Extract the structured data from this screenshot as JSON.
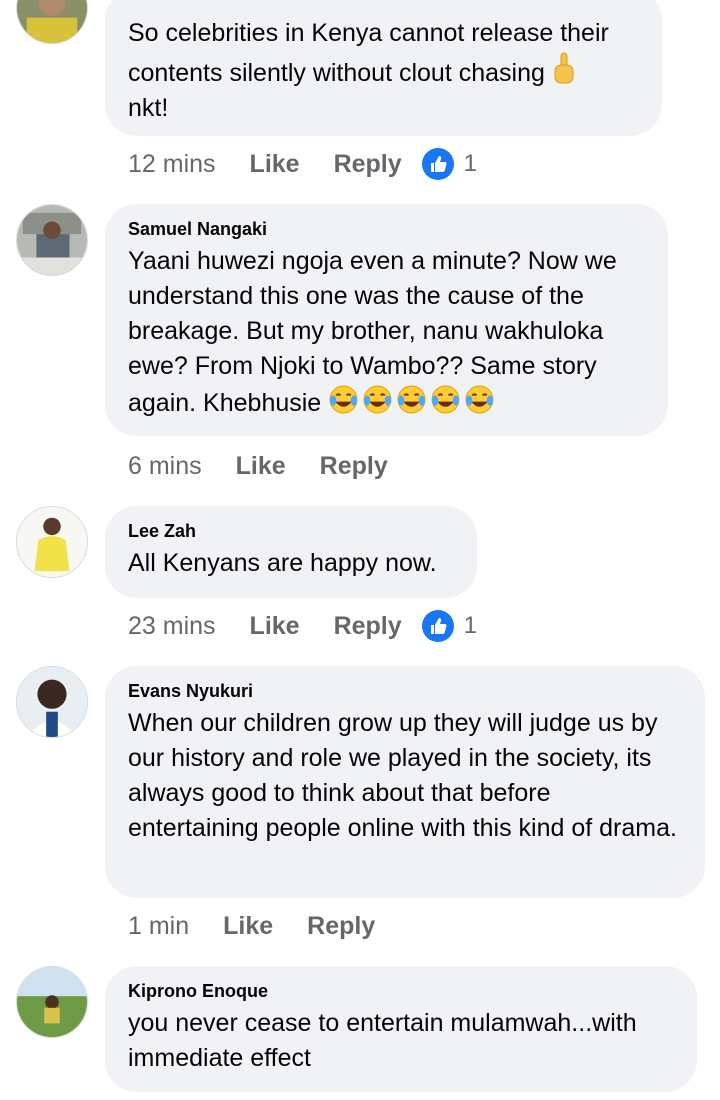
{
  "comments": [
    {
      "author": "",
      "text": "So celebrities in Kenya cannot release their contents silently without clout chasing",
      "text_end": "nkt!",
      "inline_icon": "middle-finger-icon",
      "time": "12 mins",
      "like_label": "Like",
      "reply_label": "Reply",
      "reaction_icon": "like-reaction-icon",
      "reaction_count": "1"
    },
    {
      "author": "Samuel Nangaki",
      "text": "Yaani huwezi ngoja even a minute? Now we understand this one was the cause of the breakage. But my brother, nanu wakhuloka ewe? From Njoki to Wambo?? Same story again. Khebhusie",
      "emojis": [
        "face-with-tears-of-joy-icon",
        "face-with-tears-of-joy-icon",
        "face-with-tears-of-joy-icon",
        "face-with-tears-of-joy-icon",
        "face-with-tears-of-joy-icon"
      ],
      "time": "6 mins",
      "like_label": "Like",
      "reply_label": "Reply"
    },
    {
      "author": "Lee Zah",
      "text": "All Kenyans are happy now.",
      "time": "23 mins",
      "like_label": "Like",
      "reply_label": "Reply",
      "reaction_icon": "like-reaction-icon",
      "reaction_count": "1"
    },
    {
      "author": "Evans Nyukuri",
      "text": "When our children grow up they will judge us by our history and role we played in the society, its always good to think about that before entertaining people online with this kind of drama.",
      "time": "1 min",
      "like_label": "Like",
      "reply_label": "Reply"
    },
    {
      "author": "Kiprono Enoque",
      "text": "you never cease to entertain mulamwah...with immediate effect"
    }
  ],
  "colors": {
    "bubble": "#f0f2f5",
    "meta": "#65676b",
    "like_blue": "#1877f2",
    "text": "#050505"
  }
}
